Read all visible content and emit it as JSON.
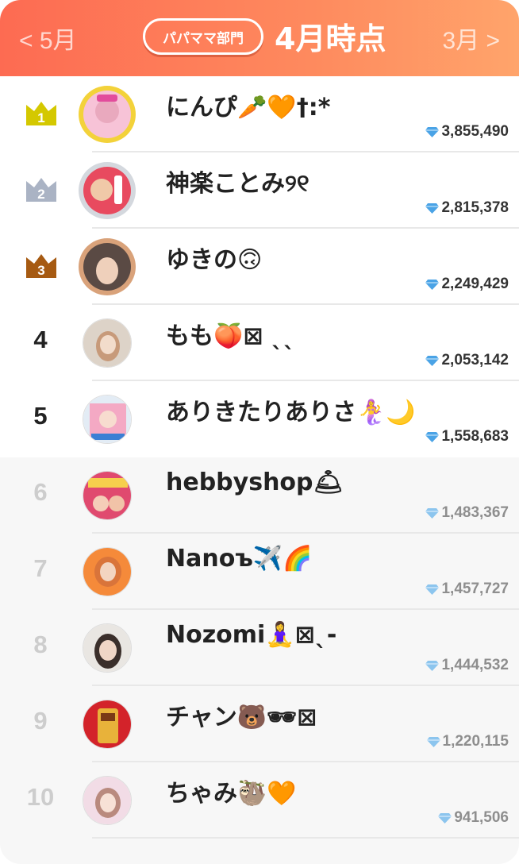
{
  "header": {
    "prev_label": "< 5月",
    "next_label": "3月 >",
    "category_label": "パパママ部門",
    "period_label": "4月時点"
  },
  "colors": {
    "header_gradient_start": "#fd6b52",
    "header_gradient_end": "#ffa46b",
    "gold": "#d4c800",
    "silver": "#aab3c4",
    "bronze": "#a65a12",
    "diamond": "#4aa3e6"
  },
  "icons": {
    "score": "diamond-icon",
    "rank_badge": "crown-icon"
  },
  "ranking": [
    {
      "rank": "1",
      "name": "にんぴ🥕🧡†:*",
      "score": "3,855,490"
    },
    {
      "rank": "2",
      "name": "神楽ことみ୨୧",
      "score": "2,815,378"
    },
    {
      "rank": "3",
      "name": "ゆきの🙃",
      "score": "2,249,429"
    },
    {
      "rank": "4",
      "name": "もも🍑⊠ ˎˎ",
      "score": "2,053,142"
    },
    {
      "rank": "5",
      "name": "ありきたりありさ🧜‍♀️🌙",
      "score": "1,558,683"
    },
    {
      "rank": "6",
      "name": "hebbyshop🛎",
      "score": "1,483,367"
    },
    {
      "rank": "7",
      "name": "Nanoъ✈️🌈",
      "score": "1,457,727"
    },
    {
      "rank": "8",
      "name": "Nozomi🧘‍♀️⊠ˎ-",
      "score": "1,444,532"
    },
    {
      "rank": "9",
      "name": "チャン🐻🕶⊠",
      "score": "1,220,115"
    },
    {
      "rank": "10",
      "name": "ちゃみ🦥🧡",
      "score": "941,506"
    }
  ]
}
